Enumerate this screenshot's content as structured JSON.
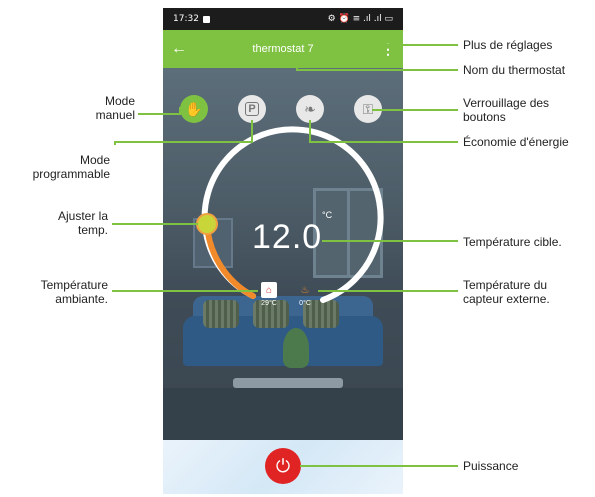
{
  "status_bar": {
    "time": "17:32",
    "icons": "⚙ ⏰ ≡ .ıl .ıl ▭"
  },
  "app_bar": {
    "back_icon": "←",
    "title": "thermostat 7",
    "more_icon": "⋮"
  },
  "modes": [
    {
      "name": "manual-mode",
      "icon": "✋",
      "active": true
    },
    {
      "name": "program-mode",
      "icon": "P",
      "active": false
    },
    {
      "name": "eco-mode",
      "icon": "❧",
      "active": false
    },
    {
      "name": "lock-mode",
      "icon": "⚿",
      "active": false
    }
  ],
  "dial": {
    "target_temp": "12.0",
    "unit": "°C"
  },
  "sensors": {
    "room": {
      "icon": "⌂",
      "value": "29°C"
    },
    "external": {
      "icon": "♨",
      "value": "0°C"
    }
  },
  "power_icon": "⏻",
  "annotations": {
    "more_settings": "Plus de réglages",
    "thermostat_name": "Nom du thermostat",
    "manual_mode": "Mode\nmanuel",
    "lock": "Verrouillage des\nboutons",
    "programmable": "Mode\nprogrammable",
    "energy_saving": "Économie d'énergie",
    "adjust_temp": "Ajuster la\ntemp.",
    "target_temp": "Température cible.",
    "ambient": "Température\nambiante.",
    "external_sensor": "Température du\ncapteur externe.",
    "power": "Puissance"
  },
  "colors": {
    "accent": "#7fc241",
    "dial_heat": "#f08a2a",
    "knob": "#c9d63a",
    "power": "#e02424"
  }
}
